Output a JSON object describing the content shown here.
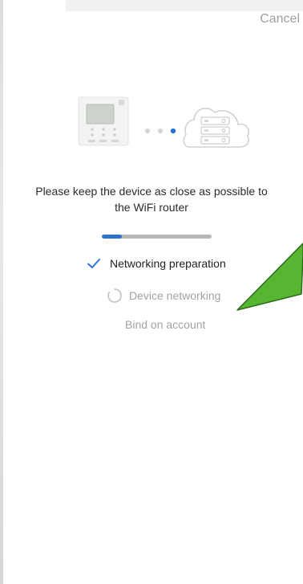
{
  "header": {
    "cancel_label": "Cancel"
  },
  "message": "Please keep the device as close as possible to the WiFi router",
  "progress": {
    "fraction": 0.18
  },
  "steps": [
    {
      "label": "Networking preparation",
      "state": "done",
      "icon": "check-icon"
    },
    {
      "label": "Device networking",
      "state": "in-progress",
      "icon": "loading-icon"
    },
    {
      "label": "Bind on account",
      "state": "pending"
    }
  ],
  "colors": {
    "accent": "#2c73d2",
    "arrow": "#56b632"
  }
}
